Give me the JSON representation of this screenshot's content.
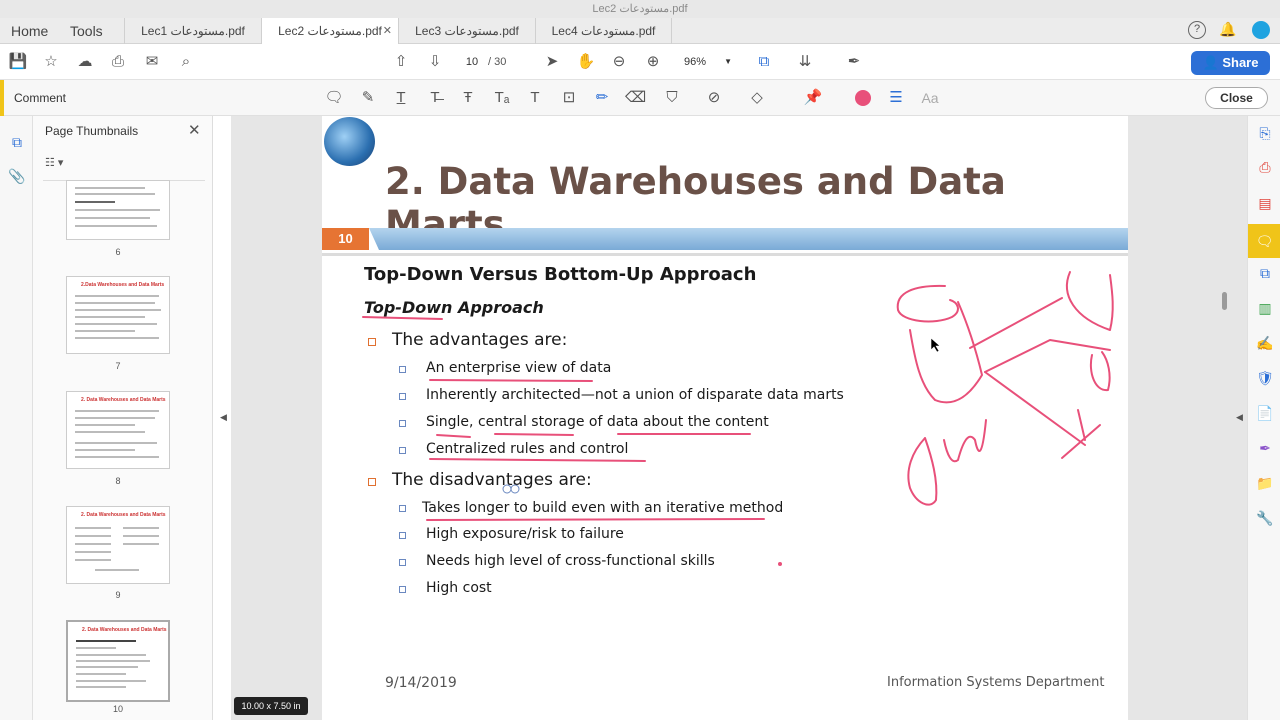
{
  "window_title": "Lec2 مستودعات.pdf",
  "nav": {
    "home": "Home",
    "tools": "Tools"
  },
  "tabs": [
    {
      "label": "Lec1 مستودعات.pdf"
    },
    {
      "label": "Lec2 مستودعات.pdf"
    },
    {
      "label": "Lec3 مستودعات.pdf"
    },
    {
      "label": "Lec4 مستودعات.pdf"
    }
  ],
  "toolbar": {
    "page_current": "10",
    "page_total": "/ 30",
    "zoom": "96%",
    "share_label": "Share",
    "icons": [
      "save-icon",
      "bookmark-star-icon",
      "upload-icon",
      "print-icon",
      "email-icon",
      "zoom-search-icon",
      "page-up-icon",
      "page-down-icon",
      "select-cursor-icon",
      "hand-icon",
      "zoom-out-icon",
      "zoom-in-icon",
      "fit-page-icon",
      "scroll-mode-icon",
      "sign-icon"
    ]
  },
  "comment_bar": {
    "label": "Comment",
    "close_label": "Close",
    "accent_color": "#f0c419",
    "pen_color": "#e8507a"
  },
  "thumbnails": {
    "title": "Page Thumbnails",
    "pages": [
      {
        "num": "6",
        "title": ""
      },
      {
        "num": "7",
        "title": "2.Data Warehouses and Data Marts"
      },
      {
        "num": "8",
        "title": "2. Data Warehouses and Data Marts"
      },
      {
        "num": "9",
        "title": "2. Data Warehouses and Data Marts"
      },
      {
        "num": "10",
        "title": "2. Data Warehouses and Data Marts"
      }
    ]
  },
  "slide": {
    "number": "10",
    "title": "2. Data Warehouses and Data Marts",
    "heading": "Top-Down Versus Bottom-Up Approach",
    "subheading": "Top-Down Approach",
    "adv_heading": "The advantages are:",
    "advantages": [
      "An enterprise view of data",
      "Inherently architected—not a union of disparate data marts",
      "Single, central storage of data about the content",
      "Centralized rules and control"
    ],
    "disadv_heading": "The disadvantages are:",
    "disadvantages": [
      "Takes longer to build even with an iterative method",
      "High exposure/risk to failure",
      "Needs high level of cross-functional skills",
      "High cost"
    ],
    "footer_date": "9/14/2019",
    "footer_dept": "Information Systems Department"
  },
  "page_size_label": "10.00 x 7.50 in",
  "right_tools": [
    "export-pdf-icon",
    "create-pdf-icon",
    "organize-pages-icon",
    "comment-icon",
    "combine-files-icon",
    "edit-pdf-icon",
    "fill-sign-icon",
    "protect-icon",
    "pdf-icon",
    "sign-pen-icon",
    "send-file-icon",
    "tools-icon"
  ]
}
